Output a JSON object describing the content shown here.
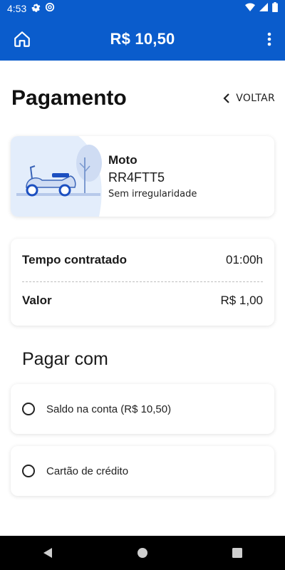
{
  "status_bar": {
    "time": "4:53"
  },
  "app_bar": {
    "balance": "R$ 10,50"
  },
  "page": {
    "title": "Pagamento",
    "back_label": "VOLTAR"
  },
  "vehicle": {
    "type": "Moto",
    "plate": "RR4FTT5",
    "status": "Sem irregularidade"
  },
  "summary": {
    "rows": [
      {
        "label": "Tempo contratado",
        "value": "01:00h"
      },
      {
        "label": "Valor",
        "value": "R$ 1,00"
      }
    ]
  },
  "payment": {
    "title": "Pagar com",
    "options": [
      {
        "label": "Saldo na conta (R$ 10,50)"
      },
      {
        "label": "Cartão de crédito"
      }
    ]
  },
  "colors": {
    "primary": "#0a5ccc",
    "illustration_bg": "#e3edfb"
  }
}
